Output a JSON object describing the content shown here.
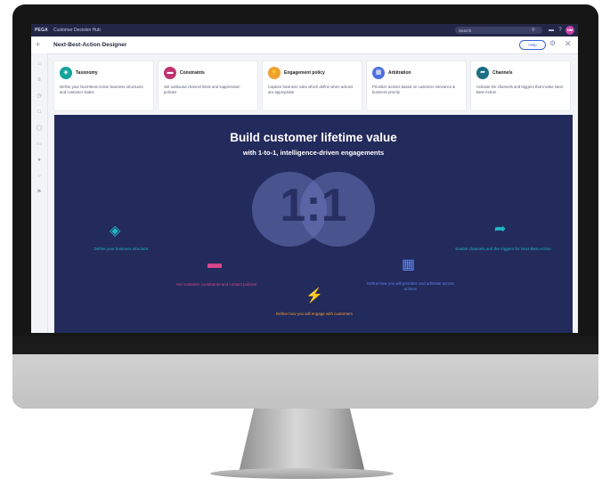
{
  "topbar": {
    "brand": "PEGA",
    "app_name": "Customer Decision Hub",
    "search_placeholder": "Search",
    "avatar_initials": "NM"
  },
  "titlebar": {
    "title": "Next-Best-Action Designer",
    "help_label": "Help"
  },
  "cards": [
    {
      "title": "Taxonomy",
      "desc": "Define your Next-Best-Action business structures and customer states",
      "color": "#12a39a",
      "icon": "taxonomy-icon"
    },
    {
      "title": "Constraints",
      "desc": "Set outbound channel limits and suppression policies",
      "color": "#c0336e",
      "icon": "constraints-icon"
    },
    {
      "title": "Engagement policy",
      "desc": "Capture business rules which define when actions are appropriate",
      "color": "#f0a030",
      "icon": "engagement-icon"
    },
    {
      "title": "Arbitration",
      "desc": "Prioritize actions based on customer relevance & business priority",
      "color": "#4e6fe0",
      "icon": "arbitration-icon"
    },
    {
      "title": "Channels",
      "desc": "Activate the channels and triggers that invoke Next-Best-Action",
      "color": "#1a6e86",
      "icon": "channels-icon"
    }
  ],
  "hero": {
    "title": "Build customer lifetime value",
    "subtitle": "with 1-to-1, intelligence-driven engagements",
    "ratio": "1:1",
    "steps": [
      {
        "label": "Define your business structure",
        "color": "#1fb8c4"
      },
      {
        "label": "Set customer constraints and contact policies",
        "color": "#d9468c"
      },
      {
        "label": "Define how you will engage with customers",
        "color": "#f0a030"
      },
      {
        "label": "Define how you will prioritize and arbitrate across actions",
        "color": "#5e86ef"
      },
      {
        "label": "Enable channels and the triggers for Next-Best-Action",
        "color": "#1fb8c4"
      }
    ]
  }
}
